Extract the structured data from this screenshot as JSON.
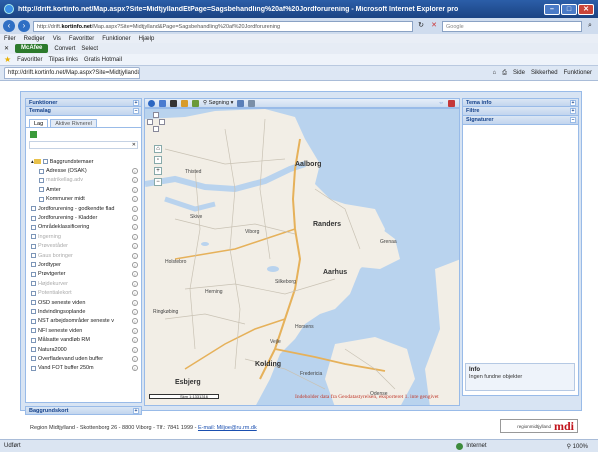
{
  "window": {
    "title": "http://drift.kortinfo.net/Map.aspx?Site=MidtjyllandEtPage=Sagsbehandling%20af%20Jordforurening - Microsoft Internet Explorer pro"
  },
  "address": {
    "url_prefix": "http://drift.",
    "url_host": "kortinfo.net",
    "url_rest": "/Map.aspx?Site=Midtjylland&Page=Sagsbehandling%20af%20Jordforurening",
    "search_placeholder": "Google"
  },
  "menu": [
    "Filer",
    "Rediger",
    "Vis",
    "Favoritter",
    "Funktioner",
    "Hjælp"
  ],
  "mcafee_bar": {
    "mcafee_label": "McAfee",
    "convert_label": "Convert",
    "select_label": "Select"
  },
  "favorites_bar": {
    "favorites_label": "Favoritter",
    "tipsee_label": "Tilpas links",
    "hotmail_label": "Gratis Hotmail"
  },
  "tab": {
    "label": "http://drift.kortinfo.net/Map.aspx?Site=Midtjylland&P...",
    "tools": [
      "Side",
      "Sikkerhed",
      "Funktioner"
    ]
  },
  "left_panel": {
    "functions_header": "Funktioner",
    "theme_header": "Temalag",
    "tabs": [
      "Lag",
      "Aktive Rivnerel"
    ],
    "layers": [
      {
        "label": "Baggrundstemaer",
        "type": "folder",
        "grey": false
      },
      {
        "label": "Adresse (OSAK)",
        "type": "sub",
        "grey": false
      },
      {
        "label": "matrikellag.adv",
        "type": "sub",
        "grey": true
      },
      {
        "label": "Amter",
        "type": "sub",
        "grey": false
      },
      {
        "label": "Kommuner midt",
        "type": "sub",
        "grey": false
      },
      {
        "label": "Jordforurening - godkendte flad",
        "type": "top",
        "grey": false
      },
      {
        "label": "Jordforurening - Kladder",
        "type": "top",
        "grey": false
      },
      {
        "label": "Områdeklassificering",
        "type": "top",
        "grey": false
      },
      {
        "label": "Ingerning",
        "type": "top",
        "grey": true
      },
      {
        "label": "Prøveståder",
        "type": "top",
        "grey": true
      },
      {
        "label": "Gaus boringer",
        "type": "top",
        "grey": true
      },
      {
        "label": "Jordtyper",
        "type": "top",
        "grey": false
      },
      {
        "label": "Prøvtgerter",
        "type": "top",
        "grey": false
      },
      {
        "label": "Højdekurver",
        "type": "top",
        "grey": true
      },
      {
        "label": "Potentialekort",
        "type": "top",
        "grey": true
      },
      {
        "label": "OSD seneste viden",
        "type": "top",
        "grey": false
      },
      {
        "label": "Indvindingsoplande",
        "type": "top",
        "grey": false
      },
      {
        "label": "NST arbejdsområder seneste v",
        "type": "top",
        "grey": false
      },
      {
        "label": "NFI seneste viden",
        "type": "top",
        "grey": false
      },
      {
        "label": "Målsatte vandløb RM",
        "type": "top",
        "grey": false
      },
      {
        "label": "Natura2000",
        "type": "top",
        "grey": false
      },
      {
        "label": "Overfladevand uden buffer",
        "type": "top",
        "grey": false
      },
      {
        "label": "Vand FOT buffer 250m",
        "type": "top",
        "grey": false
      }
    ],
    "bottom_header": "Baggrundskort"
  },
  "map_toolbar": {
    "search_label": "Søgning"
  },
  "map": {
    "cities": [
      {
        "name": "Aalborg",
        "big": true
      },
      {
        "name": "Randers",
        "big": true
      },
      {
        "name": "Aarhus",
        "big": true
      },
      {
        "name": "Kolding",
        "big": true
      },
      {
        "name": "Esbjerg",
        "big": true
      },
      {
        "name": "Odense",
        "big": false
      }
    ],
    "towns": [
      "Thisted",
      "Skive",
      "Viborg",
      "Holstebro",
      "Silkeborg",
      "Herning",
      "Horsens",
      "Vejle",
      "Grenaa",
      "Ringkøbing",
      "Fredericia"
    ],
    "scale_text": "Skm  1:1331316",
    "disclaimer": "Indeholder data fra Geodatastyrelsen, eksporteret 1. inte gengivet"
  },
  "right_panel": {
    "tema_info_header": "Tema info",
    "filter_header": "Filtre",
    "signaturer_header": "Signaturer",
    "info_title": "Info",
    "info_text": "Ingen fundne objekter"
  },
  "footer": {
    "text": "Region Midtjylland - Skottenborg 26 - 8800 Viborg - Tlf.: 7841 1999 -",
    "email_label": "E-mail: Miljoe@ru.rm.dk",
    "logo_small": "regionmidtjylland",
    "logo_big": "mdi"
  },
  "status": {
    "left": "Udført",
    "zone": "Internet",
    "zoom": "100%"
  }
}
